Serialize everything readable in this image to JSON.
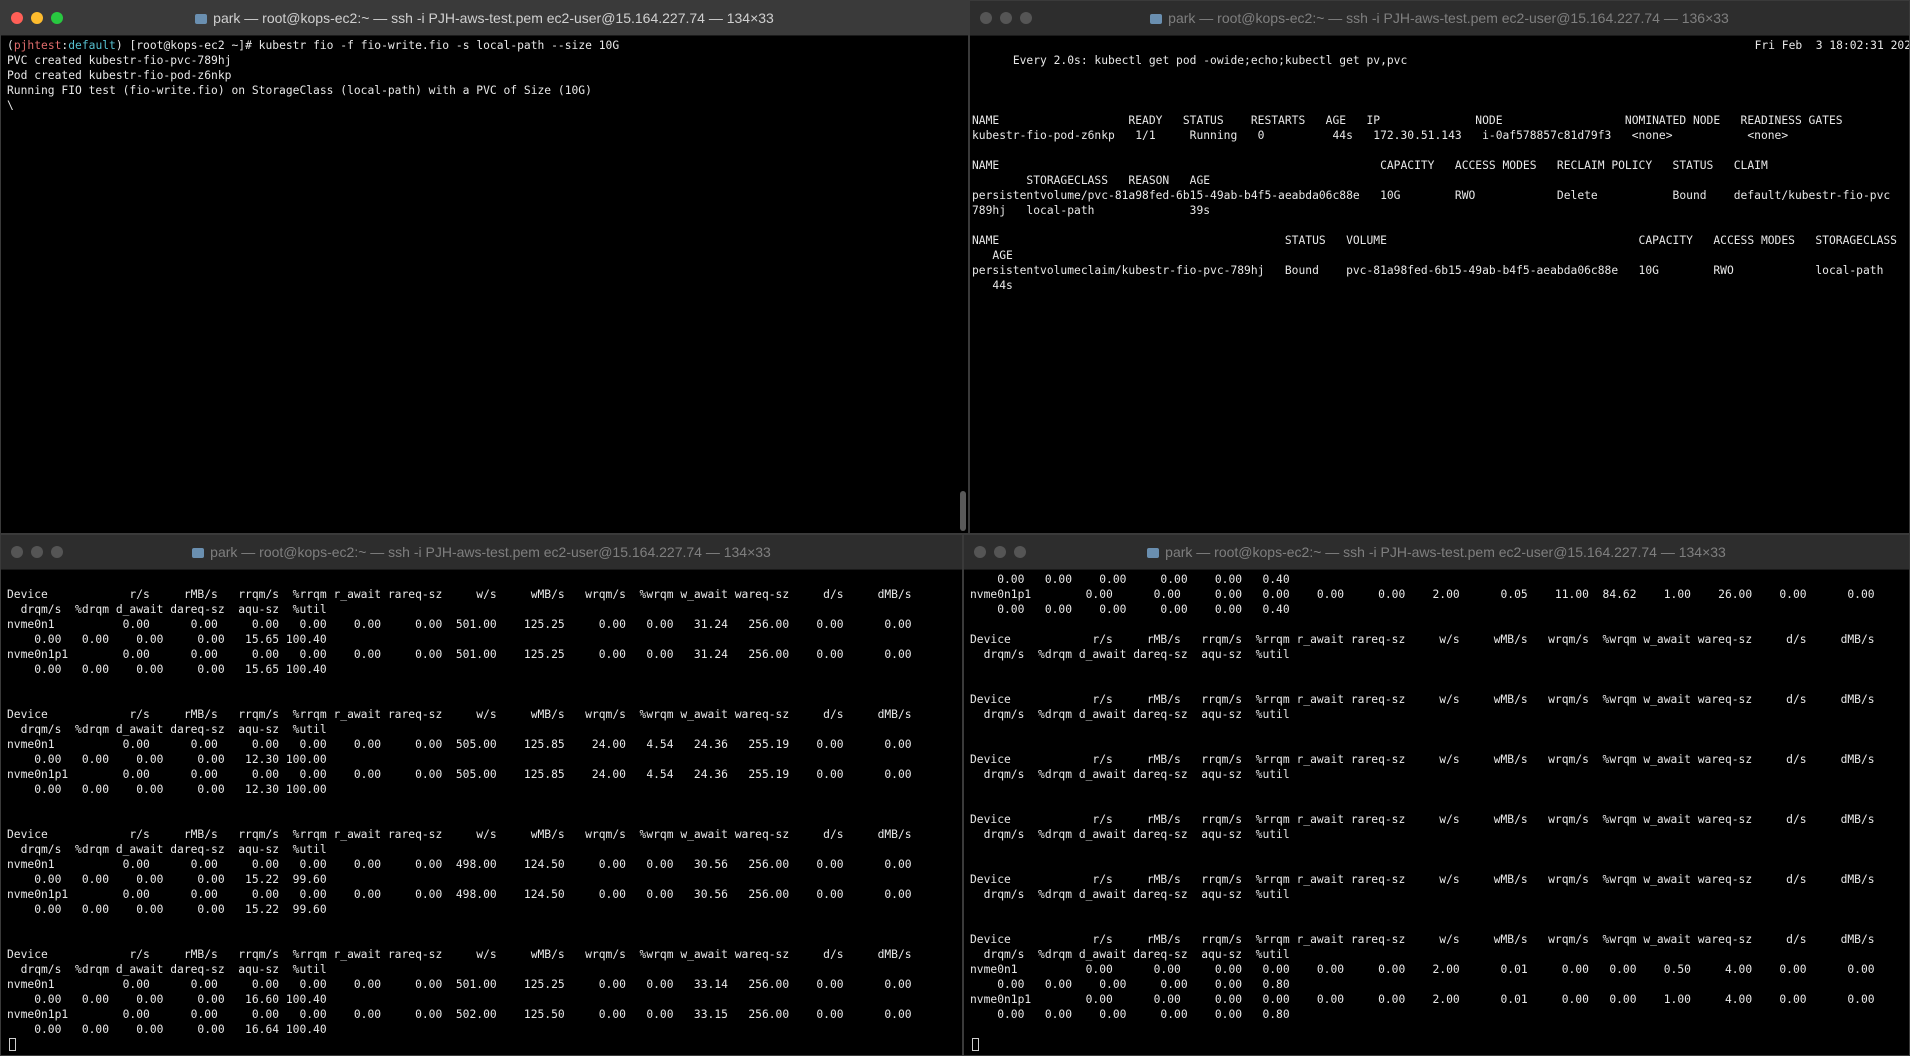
{
  "windows": {
    "top_left": {
      "title": "park — root@kops-ec2:~ — ssh -i PJH-aws-test.pem ec2-user@15.164.227.74 — 134×33",
      "prompt_ctx": "pjhtest",
      "prompt_ns": "default",
      "prompt_rest": ") [root@kops-ec2 ~]# kubestr fio -f fio-write.fio -s local-path --size 10G",
      "output": "PVC created kubestr-fio-pvc-789hj\nPod created kubestr-fio-pod-z6nkp\nRunning FIO test (fio-write.fio) on StorageClass (local-path) with a PVC of Size (10G)\n\\"
    },
    "top_right": {
      "title": "park — root@kops-ec2:~ — ssh -i PJH-aws-test.pem ec2-user@15.164.227.74 — 136×33",
      "watch_header": "Every 2.0s: kubectl get pod -owide;echo;kubectl get pv,pvc",
      "timestamp": "Fri Feb  3 18:02:31 202",
      "output": "NAME                   READY   STATUS    RESTARTS   AGE   IP              NODE                  NOMINATED NODE   READINESS GATES\nkubestr-fio-pod-z6nkp   1/1     Running   0          44s   172.30.51.143   i-0af578857c81d79f3   <none>           <none>\n\nNAME                                                        CAPACITY   ACCESS MODES   RECLAIM POLICY   STATUS   CLAIM\n        STORAGECLASS   REASON   AGE\npersistentvolume/pvc-81a98fed-6b15-49ab-b4f5-aeabda06c88e   10G        RWO            Delete           Bound    default/kubestr-fio-pvc\n789hj   local-path              39s\n\nNAME                                          STATUS   VOLUME                                     CAPACITY   ACCESS MODES   STORAGECLASS\n   AGE\npersistentvolumeclaim/kubestr-fio-pvc-789hj   Bound    pvc-81a98fed-6b15-49ab-b4f5-aeabda06c88e   10G        RWO            local-path\n   44s"
    },
    "bottom_left": {
      "title": "park — root@kops-ec2:~ — ssh -i PJH-aws-test.pem ec2-user@15.164.227.74 — 134×33",
      "output": "\nDevice            r/s     rMB/s   rrqm/s  %rrqm r_await rareq-sz     w/s     wMB/s   wrqm/s  %wrqm w_await wareq-sz     d/s     dMB/s\n  drqm/s  %drqm d_await dareq-sz  aqu-sz  %util\nnvme0n1          0.00      0.00     0.00   0.00    0.00     0.00  501.00    125.25     0.00   0.00   31.24   256.00    0.00      0.00\n    0.00   0.00    0.00     0.00   15.65 100.40\nnvme0n1p1        0.00      0.00     0.00   0.00    0.00     0.00  501.00    125.25     0.00   0.00   31.24   256.00    0.00      0.00\n    0.00   0.00    0.00     0.00   15.65 100.40\n\n\nDevice            r/s     rMB/s   rrqm/s  %rrqm r_await rareq-sz     w/s     wMB/s   wrqm/s  %wrqm w_await wareq-sz     d/s     dMB/s\n  drqm/s  %drqm d_await dareq-sz  aqu-sz  %util\nnvme0n1          0.00      0.00     0.00   0.00    0.00     0.00  505.00    125.85    24.00   4.54   24.36   255.19    0.00      0.00\n    0.00   0.00    0.00     0.00   12.30 100.00\nnvme0n1p1        0.00      0.00     0.00   0.00    0.00     0.00  505.00    125.85    24.00   4.54   24.36   255.19    0.00      0.00\n    0.00   0.00    0.00     0.00   12.30 100.00\n\n\nDevice            r/s     rMB/s   rrqm/s  %rrqm r_await rareq-sz     w/s     wMB/s   wrqm/s  %wrqm w_await wareq-sz     d/s     dMB/s\n  drqm/s  %drqm d_await dareq-sz  aqu-sz  %util\nnvme0n1          0.00      0.00     0.00   0.00    0.00     0.00  498.00    124.50     0.00   0.00   30.56   256.00    0.00      0.00\n    0.00   0.00    0.00     0.00   15.22  99.60\nnvme0n1p1        0.00      0.00     0.00   0.00    0.00     0.00  498.00    124.50     0.00   0.00   30.56   256.00    0.00      0.00\n    0.00   0.00    0.00     0.00   15.22  99.60\n\n\nDevice            r/s     rMB/s   rrqm/s  %rrqm r_await rareq-sz     w/s     wMB/s   wrqm/s  %wrqm w_await wareq-sz     d/s     dMB/s\n  drqm/s  %drqm d_await dareq-sz  aqu-sz  %util\nnvme0n1          0.00      0.00     0.00   0.00    0.00     0.00  501.00    125.25     0.00   0.00   33.14   256.00    0.00      0.00\n    0.00   0.00    0.00     0.00   16.60 100.40\nnvme0n1p1        0.00      0.00     0.00   0.00    0.00     0.00  502.00    125.50     0.00   0.00   33.15   256.00    0.00      0.00\n    0.00   0.00    0.00     0.00   16.64 100.40\n\n"
    },
    "bottom_right": {
      "title": "park — root@kops-ec2:~ — ssh -i PJH-aws-test.pem ec2-user@15.164.227.74 — 134×33",
      "output": "    0.00   0.00    0.00     0.00    0.00   0.40\nnvme0n1p1        0.00      0.00     0.00   0.00    0.00     0.00    2.00      0.05    11.00  84.62    1.00    26.00    0.00      0.00\n    0.00   0.00    0.00     0.00    0.00   0.40\n\nDevice            r/s     rMB/s   rrqm/s  %rrqm r_await rareq-sz     w/s     wMB/s   wrqm/s  %wrqm w_await wareq-sz     d/s     dMB/s\n  drqm/s  %drqm d_await dareq-sz  aqu-sz  %util\n\n\nDevice            r/s     rMB/s   rrqm/s  %rrqm r_await rareq-sz     w/s     wMB/s   wrqm/s  %wrqm w_await wareq-sz     d/s     dMB/s\n  drqm/s  %drqm d_await dareq-sz  aqu-sz  %util\n\n\nDevice            r/s     rMB/s   rrqm/s  %rrqm r_await rareq-sz     w/s     wMB/s   wrqm/s  %wrqm w_await wareq-sz     d/s     dMB/s\n  drqm/s  %drqm d_await dareq-sz  aqu-sz  %util\n\n\nDevice            r/s     rMB/s   rrqm/s  %rrqm r_await rareq-sz     w/s     wMB/s   wrqm/s  %wrqm w_await wareq-sz     d/s     dMB/s\n  drqm/s  %drqm d_await dareq-sz  aqu-sz  %util\n\n\nDevice            r/s     rMB/s   rrqm/s  %rrqm r_await rareq-sz     w/s     wMB/s   wrqm/s  %wrqm w_await wareq-sz     d/s     dMB/s\n  drqm/s  %drqm d_await dareq-sz  aqu-sz  %util\n\n\nDevice            r/s     rMB/s   rrqm/s  %rrqm r_await rareq-sz     w/s     wMB/s   wrqm/s  %wrqm w_await wareq-sz     d/s     dMB/s\n  drqm/s  %drqm d_await dareq-sz  aqu-sz  %util\nnvme0n1          0.00      0.00     0.00   0.00    0.00     0.00    2.00      0.01     0.00   0.00    0.50     4.00    0.00      0.00\n    0.00   0.00    0.00     0.00    0.00   0.80\nnvme0n1p1        0.00      0.00     0.00   0.00    0.00     0.00    2.00      0.01     0.00   0.00    1.00     4.00    0.00      0.00\n    0.00   0.00    0.00     0.00    0.00   0.80\n"
    }
  },
  "colors": {
    "close": "#ff5f57",
    "minimize": "#febc2e",
    "maximize": "#28c840",
    "prompt_context": "#e06c6c",
    "prompt_namespace": "#56c0d0"
  }
}
